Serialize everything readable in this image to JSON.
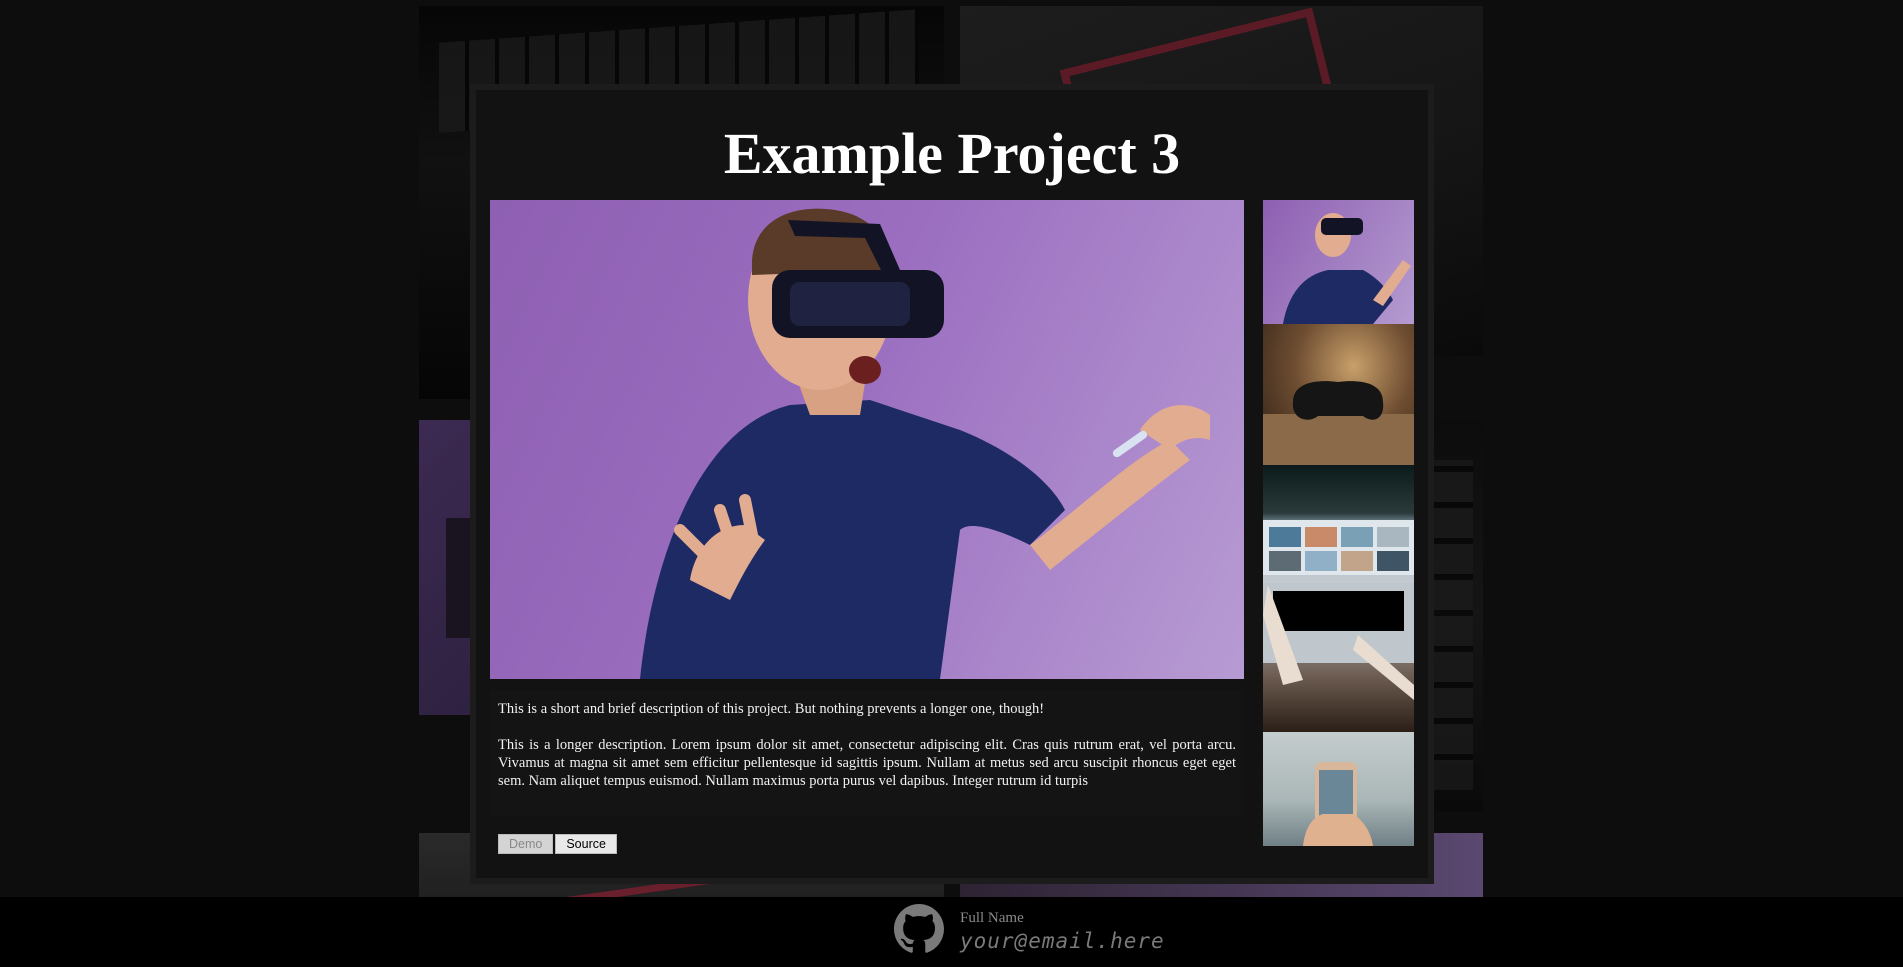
{
  "modal": {
    "title": "Example Project 3",
    "main_image_alt": "person wearing VR headset",
    "thumbnails": [
      {
        "name": "vr-headset"
      },
      {
        "name": "game-controller"
      },
      {
        "name": "laptop-photos"
      },
      {
        "name": "phone-in-hand"
      }
    ],
    "description_short": "This is a short and brief description of this project. But nothing prevents a longer one, though!",
    "description_long": "This is a longer description. Lorem ipsum dolor sit amet, consectetur adipiscing elit. Cras quis rutrum erat, vel porta arcu. Vivamus at magna sit amet sem efficitur pellentesque id sagittis ipsum. Nullam at metus sed arcu suscipit rhoncus eget eget sem. Nam aliquet tempus euismod. Nullam maximus porta purus vel dapibus. Integer rutrum id turpis",
    "buttons": {
      "demo": "Demo",
      "source": "Source"
    }
  },
  "footer": {
    "name": "Full Name",
    "email": "your@email.here",
    "icon": "github-icon"
  },
  "colors": {
    "background": "#0d0d0d",
    "modal": "#121212",
    "photo_purple": "#9b6ec0"
  }
}
